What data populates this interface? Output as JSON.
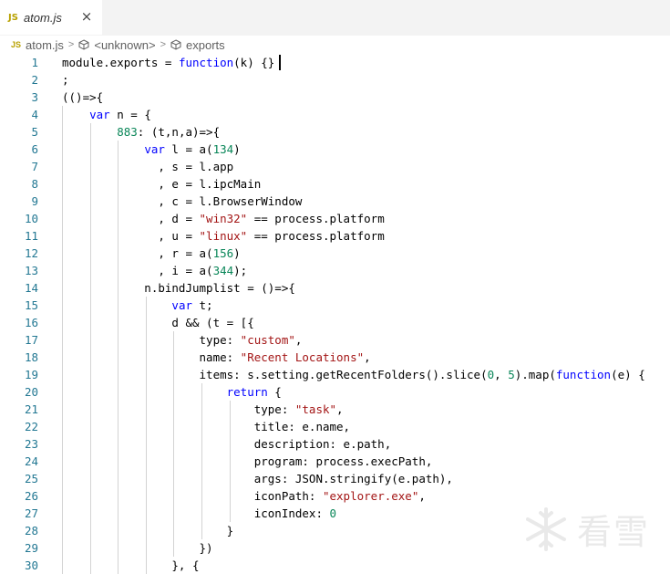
{
  "tab": {
    "icon_label": "JS",
    "title": "atom.js",
    "close_glyph": "×"
  },
  "breadcrumb": {
    "file_icon_label": "JS",
    "file": "atom.js",
    "item1": "<unknown>",
    "item2": "exports",
    "separator": ">"
  },
  "lines": [
    {
      "n": "1",
      "t": "module.exports = function(k) {}"
    },
    {
      "n": "2",
      "t": ";"
    },
    {
      "n": "3",
      "t": "(()=>{"
    },
    {
      "n": "4",
      "t": "    var n = {"
    },
    {
      "n": "5",
      "t": "        883: (t,n,a)=>{"
    },
    {
      "n": "6",
      "t": "            var l = a(134)"
    },
    {
      "n": "7",
      "t": "              , s = l.app"
    },
    {
      "n": "8",
      "t": "              , e = l.ipcMain"
    },
    {
      "n": "9",
      "t": "              , c = l.BrowserWindow"
    },
    {
      "n": "10",
      "t": "              , d = \"win32\" == process.platform"
    },
    {
      "n": "11",
      "t": "              , u = \"linux\" == process.platform"
    },
    {
      "n": "12",
      "t": "              , r = a(156)"
    },
    {
      "n": "13",
      "t": "              , i = a(344);"
    },
    {
      "n": "14",
      "t": "            n.bindJumplist = ()=>{"
    },
    {
      "n": "15",
      "t": "                var t;"
    },
    {
      "n": "16",
      "t": "                d && (t = [{"
    },
    {
      "n": "17",
      "t": "                    type: \"custom\","
    },
    {
      "n": "18",
      "t": "                    name: \"Recent Locations\","
    },
    {
      "n": "19",
      "t": "                    items: s.setting.getRecentFolders().slice(0, 5).map(function(e) {"
    },
    {
      "n": "20",
      "t": "                        return {"
    },
    {
      "n": "21",
      "t": "                            type: \"task\","
    },
    {
      "n": "22",
      "t": "                            title: e.name,"
    },
    {
      "n": "23",
      "t": "                            description: e.path,"
    },
    {
      "n": "24",
      "t": "                            program: process.execPath,"
    },
    {
      "n": "25",
      "t": "                            args: JSON.stringify(e.path),"
    },
    {
      "n": "26",
      "t": "                            iconPath: \"explorer.exe\","
    },
    {
      "n": "27",
      "t": "                            iconIndex: 0"
    },
    {
      "n": "28",
      "t": "                        }"
    },
    {
      "n": "29",
      "t": "                    })"
    },
    {
      "n": "30",
      "t": "                }, {"
    }
  ],
  "watermark": {
    "text": "看雪"
  },
  "colors": {
    "keyword": "#0000ff",
    "string": "#a31515",
    "number": "#098658",
    "line_number": "#237893"
  }
}
